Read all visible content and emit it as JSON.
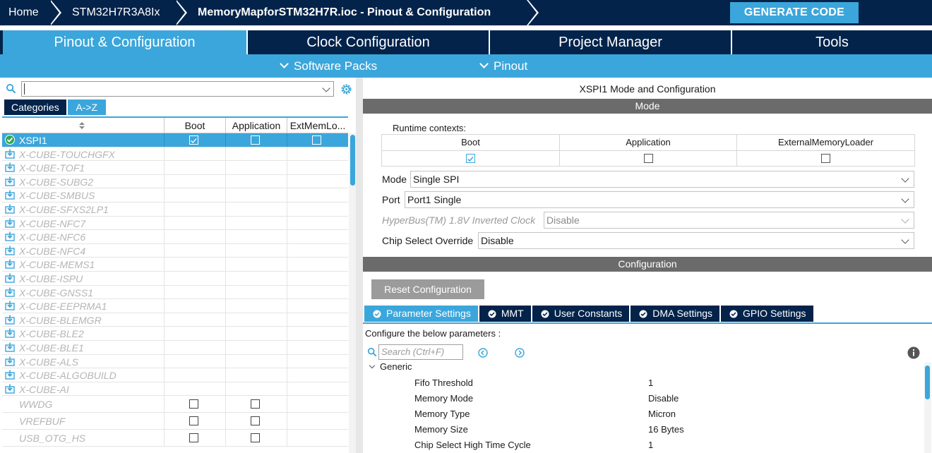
{
  "breadcrumb": {
    "items": [
      "Home",
      "STM32H7R3A8Ix",
      "MemoryMapforSTM32H7R.ioc - Pinout & Configuration"
    ],
    "generate_label": "GENERATE CODE"
  },
  "main_tabs": [
    "Pinout & Configuration",
    "Clock Configuration",
    "Project Manager",
    "Tools"
  ],
  "sub_menu": [
    "Software Packs",
    "Pinout"
  ],
  "left_panel": {
    "search_value": "",
    "category_tabs": [
      "Categories",
      "A->Z"
    ],
    "columns": [
      "Boot",
      "Application",
      "ExtMemLo..."
    ],
    "rows": [
      {
        "name": "XSPI1",
        "selected": true,
        "boot": true,
        "app": false,
        "ext": false,
        "type": "ip"
      },
      {
        "name": "X-CUBE-TOUCHGFX",
        "type": "pack"
      },
      {
        "name": "X-CUBE-TOF1",
        "type": "pack"
      },
      {
        "name": "X-CUBE-SUBG2",
        "type": "pack"
      },
      {
        "name": "X-CUBE-SMBUS",
        "type": "pack"
      },
      {
        "name": "X-CUBE-SFXS2LP1",
        "type": "pack"
      },
      {
        "name": "X-CUBE-NFC7",
        "type": "pack"
      },
      {
        "name": "X-CUBE-NFC6",
        "type": "pack"
      },
      {
        "name": "X-CUBE-NFC4",
        "type": "pack"
      },
      {
        "name": "X-CUBE-MEMS1",
        "type": "pack"
      },
      {
        "name": "X-CUBE-ISPU",
        "type": "pack"
      },
      {
        "name": "X-CUBE-GNSS1",
        "type": "pack"
      },
      {
        "name": "X-CUBE-EEPRMA1",
        "type": "pack"
      },
      {
        "name": "X-CUBE-BLEMGR",
        "type": "pack"
      },
      {
        "name": "X-CUBE-BLE2",
        "type": "pack"
      },
      {
        "name": "X-CUBE-BLE1",
        "type": "pack"
      },
      {
        "name": "X-CUBE-ALS",
        "type": "pack"
      },
      {
        "name": "X-CUBE-ALGOBUILD",
        "type": "pack"
      },
      {
        "name": "X-CUBE-AI",
        "type": "pack"
      },
      {
        "name": "WWDG",
        "type": "plain",
        "boot": false,
        "app": false
      },
      {
        "name": "VREFBUF",
        "type": "plain",
        "boot": false,
        "app": false
      },
      {
        "name": "USB_OTG_HS",
        "type": "plain",
        "boot": false,
        "app": false
      }
    ]
  },
  "right_panel": {
    "title": "XSPI1 Mode and Configuration",
    "mode_band": "Mode",
    "runtime_label": "Runtime contexts:",
    "contexts": [
      {
        "label": "Boot",
        "checked": true
      },
      {
        "label": "Application",
        "checked": false
      },
      {
        "label": "ExternalMemoryLoader",
        "checked": false
      }
    ],
    "fields": [
      {
        "label": "Mode",
        "value": "Single SPI",
        "disabled": false
      },
      {
        "label": "Port",
        "value": "Port1 Single",
        "disabled": false
      },
      {
        "label": "HyperBus(TM) 1.8V Inverted Clock",
        "value": "Disable",
        "disabled": true
      },
      {
        "label": "Chip Select Override",
        "value": "Disable",
        "disabled": false
      }
    ],
    "config_band": "Configuration",
    "reset_label": "Reset Configuration",
    "config_tabs": [
      "Parameter Settings",
      "MMT",
      "User Constants",
      "DMA Settings",
      "GPIO Settings"
    ],
    "hint": "Configure the below parameters :",
    "search_placeholder": "Search (Ctrl+F)",
    "group": "Generic",
    "params": [
      {
        "name": "Fifo Threshold",
        "value": "1"
      },
      {
        "name": "Memory Mode",
        "value": "Disable"
      },
      {
        "name": "Memory Type",
        "value": "Micron"
      },
      {
        "name": "Memory Size",
        "value": "16 Bytes"
      },
      {
        "name": "Chip Select High Time Cycle",
        "value": "1"
      }
    ]
  },
  "colors": {
    "navy": "#03234b",
    "accent": "#3ba6db",
    "band": "#6b6b6b"
  }
}
